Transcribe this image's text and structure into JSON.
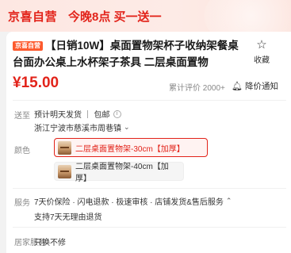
{
  "banner": {
    "brand": "京喜自营",
    "promo": "今晚8点 买一送一"
  },
  "product": {
    "tag": "京喜自营",
    "title": "【日销10W】桌面置物架杯子收纳架餐桌台面办公桌上水杯架子茶具 二层桌面置物",
    "favorite_label": "收藏",
    "price": "¥15.00",
    "rating": "累计评价 2000+",
    "notify_label": "降价通知"
  },
  "shipping": {
    "label": "送至",
    "text": "预计明天发货 ｜ 包邮",
    "address": "浙江宁波市慈溪市周巷镇"
  },
  "color": {
    "label": "颜色",
    "options": [
      {
        "label": "二层桌面置物架-30cm【加厚】",
        "selected": true
      },
      {
        "label": "二层桌面置物架-40cm【加厚】",
        "selected": false
      }
    ]
  },
  "service": {
    "label": "服务",
    "line1": "7天价保险 · 闪电退款 · 极速审核 · 店铺发货&售后服务",
    "line2": "支持7天无理由退货"
  },
  "install": {
    "label": "居家服务",
    "value": "只换不修"
  },
  "colors": {
    "accent": "#e2231a",
    "tag_bg": "#fd5a2e"
  }
}
